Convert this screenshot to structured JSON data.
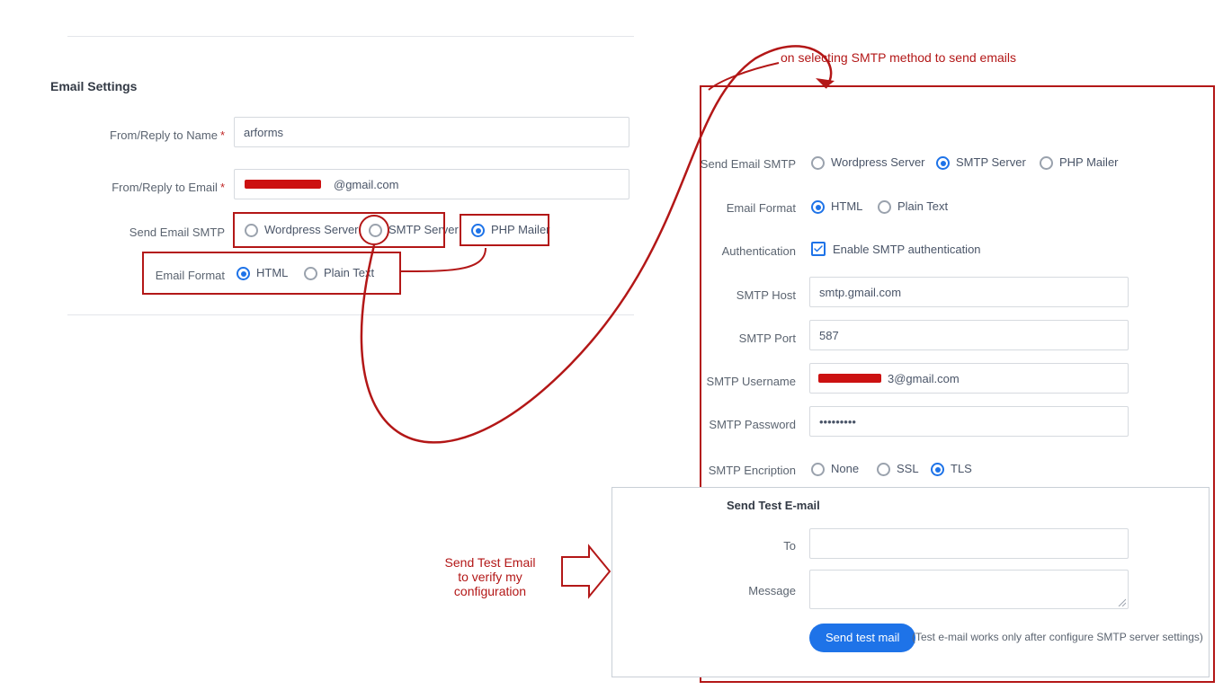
{
  "left": {
    "section_title": "Email Settings",
    "from_name_label": "From/Reply to Name",
    "from_name_value": "arforms",
    "from_email_label": "From/Reply to Email",
    "from_email_suffix": "@gmail.com",
    "send_smtp_label": "Send Email SMTP",
    "radio_wp": "Wordpress Server",
    "radio_smtp": "SMTP Server",
    "radio_php": "PHP Mailer",
    "email_format_label": "Email Format",
    "radio_html": "HTML",
    "radio_plain": "Plain Text"
  },
  "annotations": {
    "top": "on selecting SMTP method to send emails",
    "left1": "Send Test Email",
    "left2": "to verify my",
    "left3": "configuration"
  },
  "right": {
    "send_smtp_label": "Send Email SMTP",
    "radio_wp": "Wordpress Server",
    "radio_smtp": "SMTP Server",
    "radio_php": "PHP Mailer",
    "email_format_label": "Email Format",
    "radio_html": "HTML",
    "radio_plain": "Plain Text",
    "auth_label": "Authentication",
    "auth_cbx": "Enable SMTP authentication",
    "host_label": "SMTP Host",
    "host_value": "smtp.gmail.com",
    "port_label": "SMTP Port",
    "port_value": "587",
    "user_label": "SMTP Username",
    "user_suffix": "3@gmail.com",
    "pass_label": "SMTP Password",
    "pass_value": "•••••••••",
    "enc_label": "SMTP Encription",
    "radio_none": "None",
    "radio_ssl": "SSL",
    "radio_tls": "TLS",
    "test_title": "Send Test E-mail",
    "to_label": "To",
    "msg_label": "Message",
    "btn": "Send test mail",
    "hint": "(Test e-mail works only after configure SMTP server settings)"
  }
}
